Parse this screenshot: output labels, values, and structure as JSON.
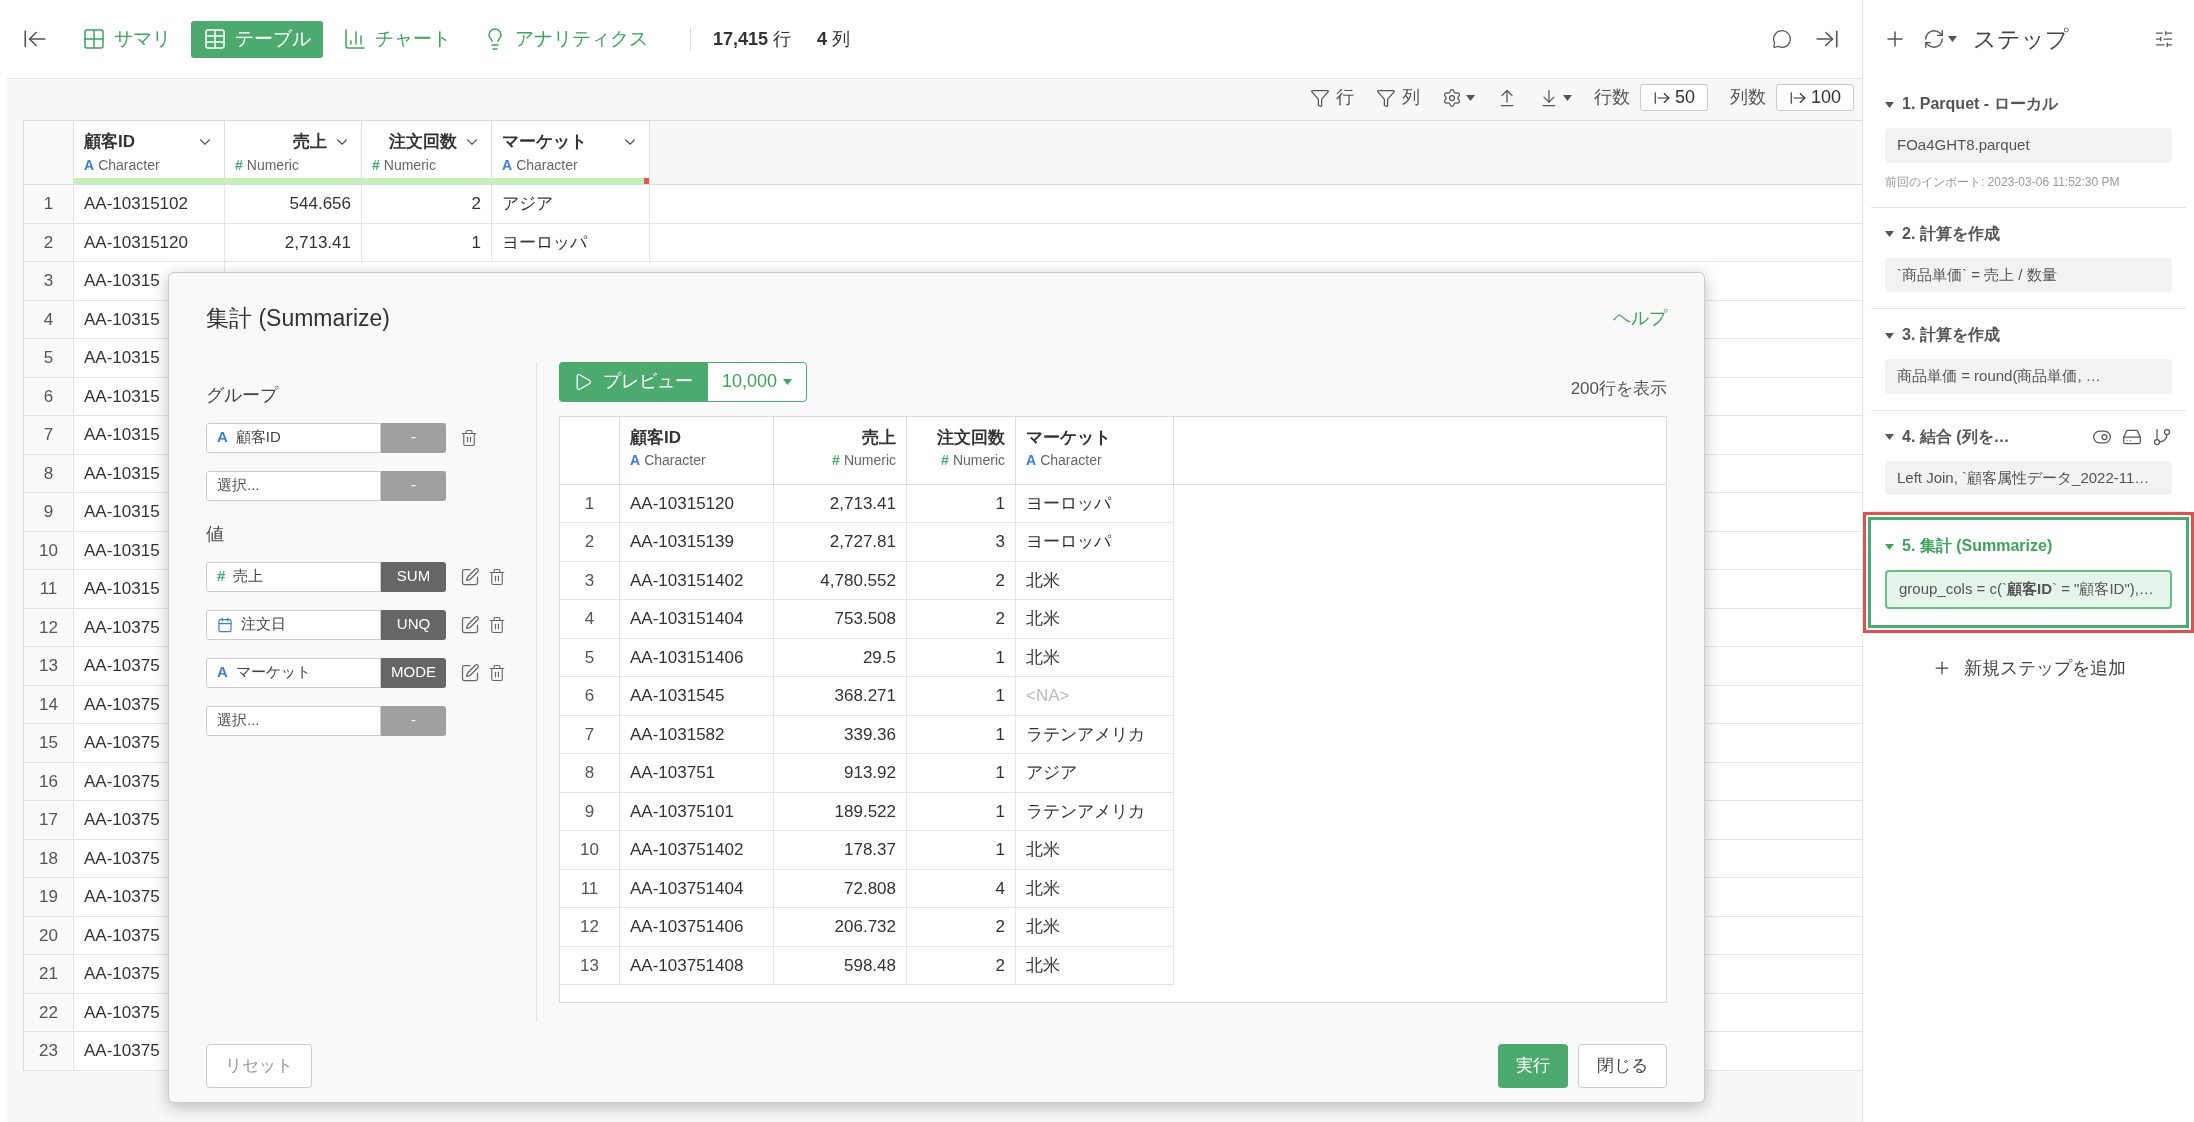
{
  "toolbar": {
    "tabs": [
      {
        "label": "サマリ",
        "selected": false
      },
      {
        "label": "テーブル",
        "selected": true
      },
      {
        "label": "チャート",
        "selected": false
      },
      {
        "label": "アナリティクス",
        "selected": false
      }
    ],
    "row_count": "17,415",
    "row_unit": "行",
    "col_count": "4",
    "col_unit": "列"
  },
  "table_toolbar": {
    "row_filter": "行",
    "col_filter": "列",
    "rows_label": "行数",
    "rows_value": "50",
    "cols_label": "列数",
    "cols_value": "100"
  },
  "table": {
    "columns": [
      {
        "name": "顧客ID",
        "kind": "character",
        "type_mark": "A",
        "type_label": "Character",
        "level": 1
      },
      {
        "name": "売上",
        "kind": "numeric",
        "type_mark": "#",
        "type_label": "Numeric",
        "level": 1
      },
      {
        "name": "注文回数",
        "kind": "numeric",
        "type_mark": "#",
        "type_label": "Numeric",
        "level": 1
      },
      {
        "name": "マーケット",
        "kind": "character",
        "type_mark": "A",
        "type_label": "Character",
        "level": 0.97
      }
    ],
    "rows": [
      {
        "n": "1",
        "cells": [
          "AA-10315102",
          "544.656",
          "2",
          "アジア"
        ]
      },
      {
        "n": "2",
        "cells": [
          "AA-10315120",
          "2,713.41",
          "1",
          "ヨーロッパ"
        ]
      },
      {
        "n": "3",
        "cells": [
          "AA-10315"
        ]
      },
      {
        "n": "4",
        "cells": [
          "AA-10315"
        ]
      },
      {
        "n": "5",
        "cells": [
          "AA-10315"
        ]
      },
      {
        "n": "6",
        "cells": [
          "AA-10315"
        ]
      },
      {
        "n": "7",
        "cells": [
          "AA-10315"
        ]
      },
      {
        "n": "8",
        "cells": [
          "AA-10315"
        ]
      },
      {
        "n": "9",
        "cells": [
          "AA-10315"
        ]
      },
      {
        "n": "10",
        "cells": [
          "AA-10315"
        ]
      },
      {
        "n": "11",
        "cells": [
          "AA-10315"
        ]
      },
      {
        "n": "12",
        "cells": [
          "AA-10375"
        ]
      },
      {
        "n": "13",
        "cells": [
          "AA-10375"
        ]
      },
      {
        "n": "14",
        "cells": [
          "AA-10375"
        ]
      },
      {
        "n": "15",
        "cells": [
          "AA-10375"
        ]
      },
      {
        "n": "16",
        "cells": [
          "AA-10375"
        ]
      },
      {
        "n": "17",
        "cells": [
          "AA-10375"
        ]
      },
      {
        "n": "18",
        "cells": [
          "AA-10375"
        ]
      },
      {
        "n": "19",
        "cells": [
          "AA-10375"
        ]
      },
      {
        "n": "20",
        "cells": [
          "AA-10375"
        ]
      },
      {
        "n": "21",
        "cells": [
          "AA-10375"
        ]
      },
      {
        "n": "22",
        "cells": [
          "AA-10375"
        ]
      },
      {
        "n": "23",
        "cells": [
          "AA-10375"
        ]
      }
    ]
  },
  "dialog": {
    "title": "集計 (Summarize)",
    "help": "ヘルプ",
    "group_label": "グループ",
    "groups": [
      {
        "kind": "character",
        "mark": "A",
        "label": "顧客ID",
        "func": "-",
        "active": false,
        "removable": true
      },
      {
        "kind": "empty",
        "placeholder": "選択...",
        "func": "-",
        "active": false,
        "removable": false
      }
    ],
    "values_label": "値",
    "values": [
      {
        "kind": "numeric",
        "mark": "#",
        "label": "売上",
        "func": "SUM",
        "active": true,
        "removable": true
      },
      {
        "kind": "date",
        "label": "注文日",
        "func": "UNQ",
        "active": true,
        "removable": true
      },
      {
        "kind": "character",
        "mark": "A",
        "label": "マーケット",
        "func": "MODE",
        "active": true,
        "removable": true
      },
      {
        "kind": "empty",
        "placeholder": "選択...",
        "func": "-",
        "active": false,
        "removable": false
      }
    ],
    "preview_button": "プレビュー",
    "sample_size": "10,000",
    "shown_rows": "200行を表示",
    "preview_table": {
      "columns": [
        {
          "name": "顧客ID",
          "kind": "character",
          "type_mark": "A",
          "type_label": "Character"
        },
        {
          "name": "売上",
          "kind": "numeric",
          "type_mark": "#",
          "type_label": "Numeric"
        },
        {
          "name": "注文回数",
          "kind": "numeric",
          "type_mark": "#",
          "type_label": "Numeric"
        },
        {
          "name": "マーケット",
          "kind": "character",
          "type_mark": "A",
          "type_label": "Character"
        }
      ],
      "rows": [
        {
          "n": "1",
          "cells": [
            "AA-10315120",
            "2,713.41",
            "1",
            "ヨーロッパ"
          ]
        },
        {
          "n": "2",
          "cells": [
            "AA-10315139",
            "2,727.81",
            "3",
            "ヨーロッパ"
          ]
        },
        {
          "n": "3",
          "cells": [
            "AA-103151402",
            "4,780.552",
            "2",
            "北米"
          ]
        },
        {
          "n": "4",
          "cells": [
            "AA-103151404",
            "753.508",
            "2",
            "北米"
          ]
        },
        {
          "n": "5",
          "cells": [
            "AA-103151406",
            "29.5",
            "1",
            "北米"
          ]
        },
        {
          "n": "6",
          "cells": [
            "AA-1031545",
            "368.271",
            "1",
            "<NA>"
          ],
          "missing": [
            false,
            false,
            false,
            true
          ]
        },
        {
          "n": "7",
          "cells": [
            "AA-1031582",
            "339.36",
            "1",
            "ラテンアメリカ"
          ]
        },
        {
          "n": "8",
          "cells": [
            "AA-103751",
            "913.92",
            "1",
            "アジア"
          ]
        },
        {
          "n": "9",
          "cells": [
            "AA-10375101",
            "189.522",
            "1",
            "ラテンアメリカ"
          ]
        },
        {
          "n": "10",
          "cells": [
            "AA-103751402",
            "178.37",
            "1",
            "北米"
          ]
        },
        {
          "n": "11",
          "cells": [
            "AA-103751404",
            "72.808",
            "4",
            "北米"
          ]
        },
        {
          "n": "12",
          "cells": [
            "AA-103751406",
            "206.732",
            "2",
            "北米"
          ]
        },
        {
          "n": "13",
          "cells": [
            "AA-103751408",
            "598.48",
            "2",
            "北米"
          ]
        }
      ]
    },
    "reset": "リセット",
    "run": "実行",
    "close": "閉じる"
  },
  "steps_panel": {
    "title": "ステップ",
    "steps": [
      {
        "kind": "import",
        "title": "1. Parquet - ローカル",
        "expanded": true,
        "selected": false,
        "highlighted": false,
        "summary": "FOa4GHT8.parquet",
        "note": "前回のインポート: 2023-03-06 11:52:30 PM"
      },
      {
        "kind": "calc",
        "title": "2. 計算を作成",
        "expanded": true,
        "selected": false,
        "highlighted": false,
        "summary": "`商品単価` = 売上 / 数量"
      },
      {
        "kind": "calc",
        "title": "3. 計算を作成",
        "expanded": true,
        "selected": false,
        "highlighted": false,
        "summary": "商品単価 = round(商品単価, …"
      },
      {
        "kind": "join",
        "title": "4. 結合 (列を…",
        "expanded": true,
        "selected": false,
        "highlighted": false,
        "summary": "Left Join, `顧客属性データ_2022-11…"
      },
      {
        "kind": "summarize",
        "title": "5. 集計 (Summarize)",
        "expanded": true,
        "selected": true,
        "highlighted": true,
        "summary": "group_cols = c(`**顧客ID**` = \"顧客ID\"),…"
      }
    ],
    "add_step": "新規ステップを追加"
  }
}
